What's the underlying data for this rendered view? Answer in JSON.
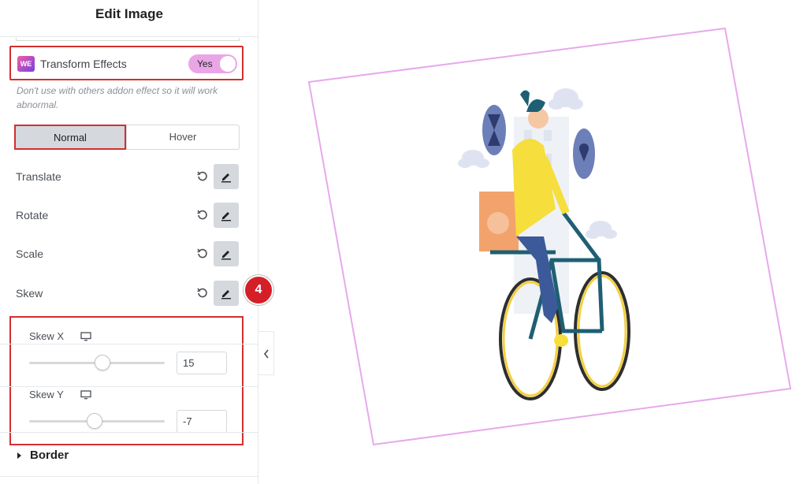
{
  "panel": {
    "title": "Edit Image",
    "transform_effects": {
      "logo_text": "WE",
      "label": "Transform Effects",
      "toggle_value": "Yes",
      "enabled": true,
      "note": "Don't use with others addon effect so it will work abnormal."
    },
    "tabs": [
      {
        "label": "Normal",
        "active": true
      },
      {
        "label": "Hover",
        "active": false
      }
    ],
    "properties": [
      {
        "label": "Translate"
      },
      {
        "label": "Rotate"
      },
      {
        "label": "Scale"
      },
      {
        "label": "Skew"
      }
    ],
    "step_badge": "4",
    "skew": {
      "x": {
        "label": "Skew X",
        "value": "15",
        "slider_fraction": 0.54
      },
      "y": {
        "label": "Skew Y",
        "value": "-7",
        "slider_fraction": 0.48
      }
    },
    "border_section": "Border"
  },
  "colors": {
    "highlight_red": "#d32f2f",
    "toggle_pink": "#e9a6e6",
    "frame_pink": "#e7a9ec",
    "badge_red": "#d51f28"
  },
  "preview": {
    "image": "delivery-cyclist-illustration",
    "icons": [
      "hourglass-icon",
      "location-pin-icon",
      "cloud-icon"
    ]
  }
}
